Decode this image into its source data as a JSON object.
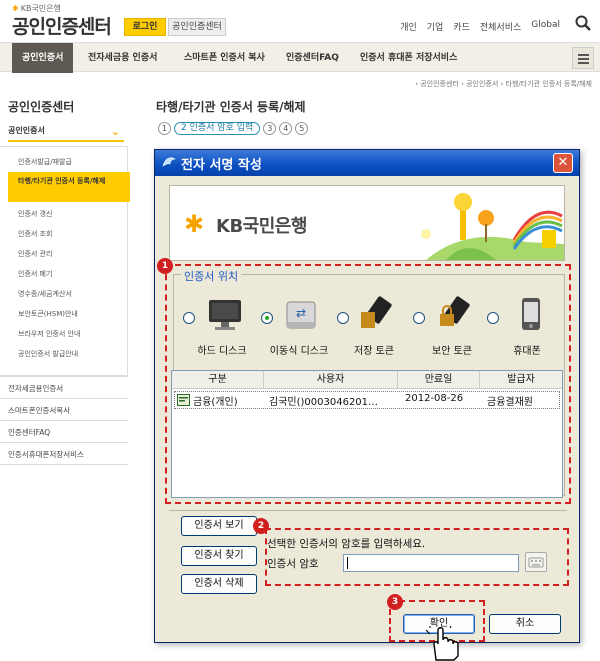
{
  "header": {
    "kb_small": "KB국민은행",
    "title": "공인인증센터",
    "login_label": "로그인",
    "cert_label": "공인인증센터",
    "topnav": [
      "개인",
      "기업",
      "카드",
      "전체서비스",
      "Global"
    ]
  },
  "gnb": {
    "items": [
      "공인인증서",
      "전자세금용 인증서",
      "스마트폰 인증서 복사",
      "인증센터FAQ",
      "인증서 휴대폰 저장서비스"
    ]
  },
  "breadcrumb": "› 공인인증센터 › 공인인증서 › 타행/타기관 인증서 등록/해제",
  "sidebar": {
    "title": "공인인증센터",
    "category": "공인인증서",
    "sub_items": [
      "인증서발급/재발급",
      "타행/타기관 인증서 등록/해제",
      "인증서 갱신",
      "인증서 조회",
      "인증서 관리",
      "인증서 폐기",
      "영수증/세금계산서",
      "보안토큰(HSM)안내",
      "브라우저 인증서 안내",
      "공인인증서 발급안내"
    ],
    "main_items": [
      "전자세금용인증서",
      "스마트폰인증서복사",
      "인증센터FAQ",
      "인증서휴대폰저장서비스"
    ]
  },
  "content": {
    "title": "타행/타기관 인증서 등록/해제",
    "steps": [
      "1",
      "2 인증서 암호 입력",
      "3",
      "4",
      "5"
    ]
  },
  "dialog": {
    "title": "전자 서명 작성",
    "bank_name": "KB국민은행",
    "location_legend": "인증서 위치",
    "devices": [
      {
        "label": "하드 디스크",
        "icon": "monitor-icon",
        "selected": false
      },
      {
        "label": "이동식 디스크",
        "icon": "removable-disk-icon",
        "selected": true
      },
      {
        "label": "저장 토큰",
        "icon": "token-icon",
        "selected": false
      },
      {
        "label": "보안 토큰",
        "icon": "security-token-icon",
        "selected": false
      },
      {
        "label": "휴대폰",
        "icon": "phone-icon",
        "selected": false
      }
    ],
    "table": {
      "headers": [
        "구분",
        "사용자",
        "만료일",
        "발급자"
      ],
      "rows": [
        {
          "type": "금융(개인)",
          "user": "김국민()0003046201…",
          "expiry": "2012-08-26",
          "issuer": "금융결재원"
        }
      ]
    },
    "buttons": {
      "view": "인증서 보기",
      "find": "인증서 찾기",
      "delete": "인증서 삭제",
      "ok": "확인",
      "cancel": "취소"
    },
    "prompt": "선택한 인증서의 암호를 입력하세요.",
    "password_label": "인증서 암호",
    "badges": [
      "1",
      "2",
      "3"
    ]
  },
  "colors": {
    "accent_yellow": "#ffcc00",
    "highlight_red": "#d21f1f",
    "titlebar_blue": "#0a4fc2"
  }
}
